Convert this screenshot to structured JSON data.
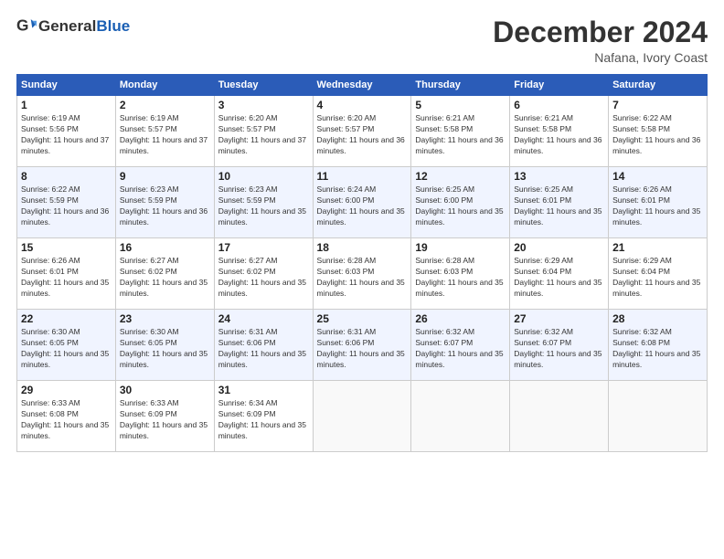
{
  "logo": {
    "text_general": "General",
    "text_blue": "Blue"
  },
  "header": {
    "month": "December 2024",
    "location": "Nafana, Ivory Coast"
  },
  "weekdays": [
    "Sunday",
    "Monday",
    "Tuesday",
    "Wednesday",
    "Thursday",
    "Friday",
    "Saturday"
  ],
  "weeks": [
    [
      {
        "day": "1",
        "sunrise": "6:19 AM",
        "sunset": "5:56 PM",
        "daylight": "11 hours and 37 minutes."
      },
      {
        "day": "2",
        "sunrise": "6:19 AM",
        "sunset": "5:57 PM",
        "daylight": "11 hours and 37 minutes."
      },
      {
        "day": "3",
        "sunrise": "6:20 AM",
        "sunset": "5:57 PM",
        "daylight": "11 hours and 37 minutes."
      },
      {
        "day": "4",
        "sunrise": "6:20 AM",
        "sunset": "5:57 PM",
        "daylight": "11 hours and 36 minutes."
      },
      {
        "day": "5",
        "sunrise": "6:21 AM",
        "sunset": "5:58 PM",
        "daylight": "11 hours and 36 minutes."
      },
      {
        "day": "6",
        "sunrise": "6:21 AM",
        "sunset": "5:58 PM",
        "daylight": "11 hours and 36 minutes."
      },
      {
        "day": "7",
        "sunrise": "6:22 AM",
        "sunset": "5:58 PM",
        "daylight": "11 hours and 36 minutes."
      }
    ],
    [
      {
        "day": "8",
        "sunrise": "6:22 AM",
        "sunset": "5:59 PM",
        "daylight": "11 hours and 36 minutes."
      },
      {
        "day": "9",
        "sunrise": "6:23 AM",
        "sunset": "5:59 PM",
        "daylight": "11 hours and 36 minutes."
      },
      {
        "day": "10",
        "sunrise": "6:23 AM",
        "sunset": "5:59 PM",
        "daylight": "11 hours and 35 minutes."
      },
      {
        "day": "11",
        "sunrise": "6:24 AM",
        "sunset": "6:00 PM",
        "daylight": "11 hours and 35 minutes."
      },
      {
        "day": "12",
        "sunrise": "6:25 AM",
        "sunset": "6:00 PM",
        "daylight": "11 hours and 35 minutes."
      },
      {
        "day": "13",
        "sunrise": "6:25 AM",
        "sunset": "6:01 PM",
        "daylight": "11 hours and 35 minutes."
      },
      {
        "day": "14",
        "sunrise": "6:26 AM",
        "sunset": "6:01 PM",
        "daylight": "11 hours and 35 minutes."
      }
    ],
    [
      {
        "day": "15",
        "sunrise": "6:26 AM",
        "sunset": "6:01 PM",
        "daylight": "11 hours and 35 minutes."
      },
      {
        "day": "16",
        "sunrise": "6:27 AM",
        "sunset": "6:02 PM",
        "daylight": "11 hours and 35 minutes."
      },
      {
        "day": "17",
        "sunrise": "6:27 AM",
        "sunset": "6:02 PM",
        "daylight": "11 hours and 35 minutes."
      },
      {
        "day": "18",
        "sunrise": "6:28 AM",
        "sunset": "6:03 PM",
        "daylight": "11 hours and 35 minutes."
      },
      {
        "day": "19",
        "sunrise": "6:28 AM",
        "sunset": "6:03 PM",
        "daylight": "11 hours and 35 minutes."
      },
      {
        "day": "20",
        "sunrise": "6:29 AM",
        "sunset": "6:04 PM",
        "daylight": "11 hours and 35 minutes."
      },
      {
        "day": "21",
        "sunrise": "6:29 AM",
        "sunset": "6:04 PM",
        "daylight": "11 hours and 35 minutes."
      }
    ],
    [
      {
        "day": "22",
        "sunrise": "6:30 AM",
        "sunset": "6:05 PM",
        "daylight": "11 hours and 35 minutes."
      },
      {
        "day": "23",
        "sunrise": "6:30 AM",
        "sunset": "6:05 PM",
        "daylight": "11 hours and 35 minutes."
      },
      {
        "day": "24",
        "sunrise": "6:31 AM",
        "sunset": "6:06 PM",
        "daylight": "11 hours and 35 minutes."
      },
      {
        "day": "25",
        "sunrise": "6:31 AM",
        "sunset": "6:06 PM",
        "daylight": "11 hours and 35 minutes."
      },
      {
        "day": "26",
        "sunrise": "6:32 AM",
        "sunset": "6:07 PM",
        "daylight": "11 hours and 35 minutes."
      },
      {
        "day": "27",
        "sunrise": "6:32 AM",
        "sunset": "6:07 PM",
        "daylight": "11 hours and 35 minutes."
      },
      {
        "day": "28",
        "sunrise": "6:32 AM",
        "sunset": "6:08 PM",
        "daylight": "11 hours and 35 minutes."
      }
    ],
    [
      {
        "day": "29",
        "sunrise": "6:33 AM",
        "sunset": "6:08 PM",
        "daylight": "11 hours and 35 minutes."
      },
      {
        "day": "30",
        "sunrise": "6:33 AM",
        "sunset": "6:09 PM",
        "daylight": "11 hours and 35 minutes."
      },
      {
        "day": "31",
        "sunrise": "6:34 AM",
        "sunset": "6:09 PM",
        "daylight": "11 hours and 35 minutes."
      },
      null,
      null,
      null,
      null
    ]
  ]
}
